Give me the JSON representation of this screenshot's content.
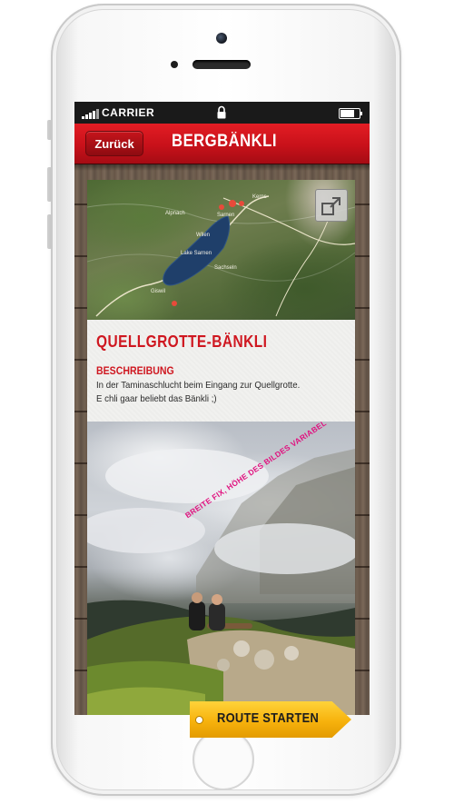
{
  "statusbar": {
    "carrier": "CARRIER",
    "battery_level": 0.85
  },
  "navbar": {
    "back_label": "Zurück",
    "title": "BERGBÄNKLI"
  },
  "map": {
    "labels": [
      "Sarnen",
      "Sachseln",
      "Lake Sarnen",
      "Giswil",
      "Kerns",
      "Alpnach",
      "Wilen"
    ]
  },
  "card": {
    "title": "QUELLGROTTE-BÄNKLI",
    "description_heading": "BESCHREIBUNG",
    "description_lines": [
      "In der Taminaschlucht beim Eingang zur Quellgrotte.",
      "E chli gaar beliebt das Bänkli ;)"
    ]
  },
  "photo": {
    "annotation": "BREITE FIX, HÖHE DES BILDES VARIABEL"
  },
  "route_button": {
    "label": "ROUTE STARTEN"
  },
  "colors": {
    "brand_red": "#cf1720",
    "route_yellow": "#f7b20d",
    "annotation_pink": "#e0127f"
  }
}
